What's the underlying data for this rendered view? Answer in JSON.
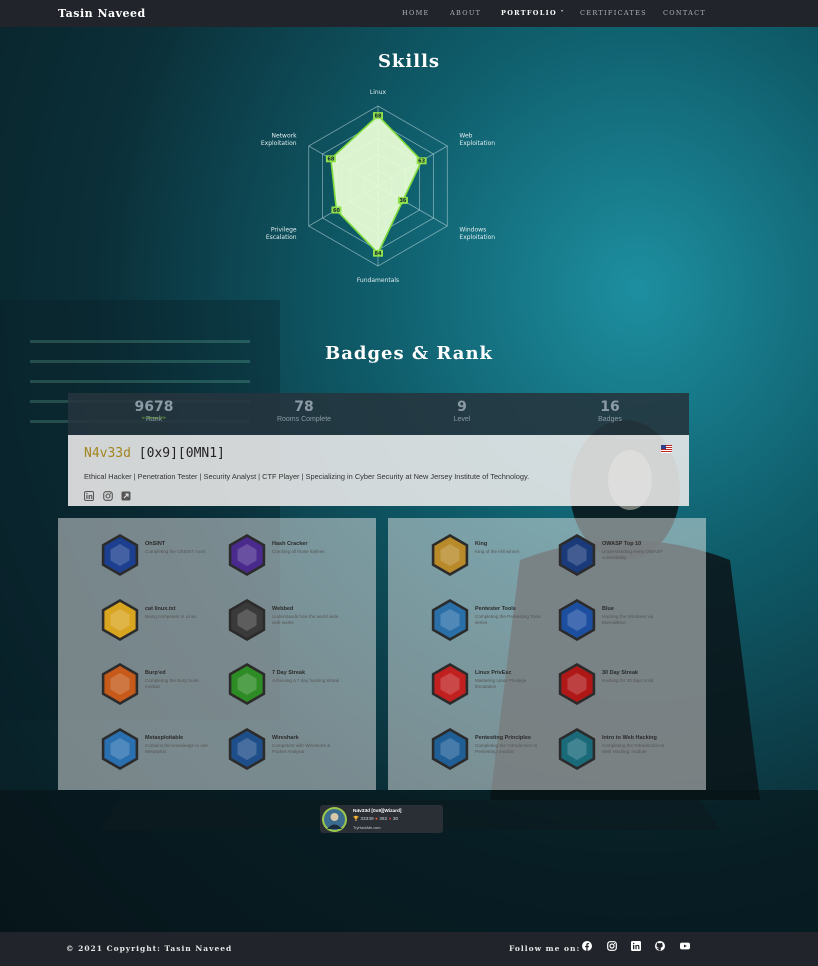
{
  "nav": {
    "brand": "Tasin Naveed",
    "items": [
      {
        "label": "HOME"
      },
      {
        "label": "ABOUT"
      },
      {
        "label": "PORTFOLIO ˅",
        "active": true
      },
      {
        "label": "CERTIFICATES"
      },
      {
        "label": "CONTACT"
      }
    ]
  },
  "skills": {
    "title": "Skills",
    "axes": [
      {
        "label": [
          "Linux"
        ],
        "value": 88
      },
      {
        "label": [
          "Web",
          "Exploitation"
        ],
        "value": 63
      },
      {
        "label": [
          "Windows",
          "Exploitation"
        ],
        "value": 36
      },
      {
        "label": [
          "Fundamentals"
        ],
        "value": 84
      },
      {
        "label": [
          "Privilege",
          "Escalation"
        ],
        "value": 60
      },
      {
        "label": [
          "Network",
          "Exploitation"
        ],
        "value": 68
      }
    ]
  },
  "badges_section": {
    "title": "Badges & Rank"
  },
  "stats": [
    {
      "value": "9678",
      "label": "Rank",
      "sub": "in the top 1%"
    },
    {
      "value": "78",
      "label": "Rooms Complete"
    },
    {
      "value": "9",
      "label": "Level"
    },
    {
      "value": "16",
      "label": "Badges"
    }
  ],
  "profile": {
    "username": "N4v33d",
    "rank_title": " [0x9][0MN1]",
    "bio": "Ethical Hacker | Penetration Tester | Security Analyst | CTF Player | Specializing in Cyber Security at New Jersey Institute of Technology."
  },
  "badges_left": [
    {
      "title": "OhSINT",
      "desc": "Completing the OhSINT room",
      "icon": "ohsint-badge-icon",
      "color": "#1c3f8f"
    },
    {
      "title": "Hash Cracker",
      "desc": "Cracking all those hashes",
      "icon": "hash-cracker-badge-icon",
      "color": "#4a2a8c"
    },
    {
      "title": "cat linux.txt",
      "desc": "Being competent in Linux",
      "icon": "linux-penguin-badge-icon",
      "color": "#d9a520"
    },
    {
      "title": "Webbed",
      "desc": "Understands how the world wide web works",
      "icon": "webbed-badge-icon",
      "color": "#3a3a3a"
    },
    {
      "title": "Burp'ed",
      "desc": "Completing the Burp Suite module",
      "icon": "burp-badge-icon",
      "color": "#c55a1a"
    },
    {
      "title": "7 Day Streak",
      "desc": "Achieving a 7 day hacking streak",
      "icon": "streak-7-badge-icon",
      "color": "#2e8c25"
    },
    {
      "title": "Metasploitable",
      "desc": "Contains the knowledge to use Metasploit",
      "icon": "metasploit-badge-icon",
      "color": "#2a6fb0"
    },
    {
      "title": "Wireshark",
      "desc": "Competent with Wireshark & Packet Analysis",
      "icon": "wireshark-badge-icon",
      "color": "#1f4f8a"
    }
  ],
  "badges_right": [
    {
      "title": "King",
      "desc": "King of the Hill winner",
      "icon": "king-crown-badge-icon",
      "color": "#b88a2a"
    },
    {
      "title": "OWASP Top 10",
      "desc": "Understanding every OWASP vulnerability",
      "icon": "owasp-bee-badge-icon",
      "color": "#1a3a7a"
    },
    {
      "title": "Pentester Tools",
      "desc": "Completing the Pentesting Tools series",
      "icon": "pentester-tools-badge-icon",
      "color": "#2a6fa8"
    },
    {
      "title": "Blue",
      "desc": "Hacking the Windows via EternalBlue",
      "icon": "blue-badge-icon",
      "color": "#1c4fa0"
    },
    {
      "title": "Linux PrivEsc",
      "desc": "Mastering Linux Privilege Escalation",
      "icon": "linux-privesc-badge-icon",
      "color": "#c02020"
    },
    {
      "title": "30 Day Streak",
      "desc": "Hacking for 30 days solid",
      "icon": "streak-30-badge-icon",
      "color": "#b01818"
    },
    {
      "title": "Pentesting Principles",
      "desc": "Completing the 'Introduction to Pentesting' module",
      "icon": "pentesting-principles-badge-icon",
      "color": "#1f5f96"
    },
    {
      "title": "Intro to Web Hacking",
      "desc": "Completing the 'Introduction to Web Hacking' module",
      "icon": "web-hacking-badge-icon",
      "color": "#1a6a7a"
    }
  ],
  "mini_card": {
    "name": "N4v33d  [0x9][Wizard]",
    "points": "33339",
    "rooms": "382",
    "badges": "30",
    "site": "TryHackMe.com"
  },
  "footer": {
    "copyright": "© 2021 Copyright: Tasin Naveed",
    "follow": "Follow me on:",
    "icons": [
      "facebook-icon",
      "instagram-icon",
      "linkedin-icon",
      "github-icon",
      "youtube-icon"
    ]
  }
}
